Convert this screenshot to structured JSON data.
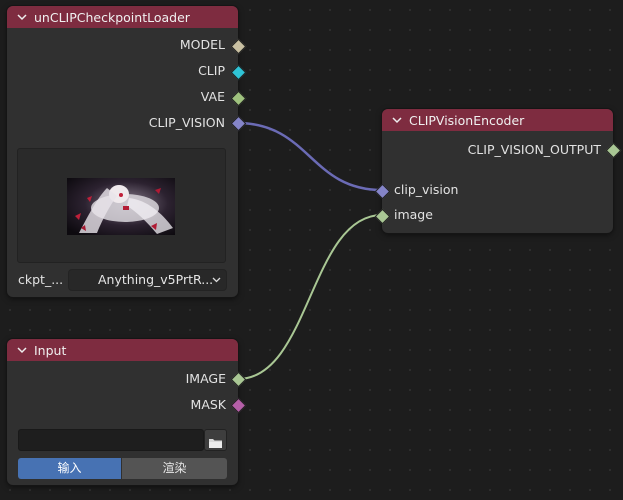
{
  "nodes": {
    "loader": {
      "title": "unCLIPCheckpointLoader",
      "outputs": [
        "MODEL",
        "CLIP",
        "VAE",
        "CLIP_VISION"
      ],
      "ckpt_label": "ckpt_...",
      "ckpt_value": "Anything_v5PrtR..."
    },
    "encoder": {
      "title": "CLIPVisionEncoder",
      "output": "CLIP_VISION_OUTPUT",
      "inputs": [
        "clip_vision",
        "image"
      ]
    },
    "input": {
      "title": "Input",
      "outputs": [
        "IMAGE",
        "MASK"
      ],
      "path_value": "",
      "mode_active": "输入",
      "mode_inactive": "渲染"
    }
  },
  "colors": {
    "header": "#7e2c40",
    "clip_vision_link": "#6b6bb5",
    "image_link": "#a9c794",
    "sock_model": "#c9c0a2",
    "sock_clip": "#2fc4d6",
    "sock_vae": "#9fc27e",
    "sock_clip_vision": "#8585c9",
    "sock_image": "#a9c794",
    "sock_mask": "#b55fa8",
    "mode_active": "#4772b3"
  },
  "icons": [
    "chevron-down-icon",
    "folder-icon",
    "dropdown-chevron-icon"
  ]
}
